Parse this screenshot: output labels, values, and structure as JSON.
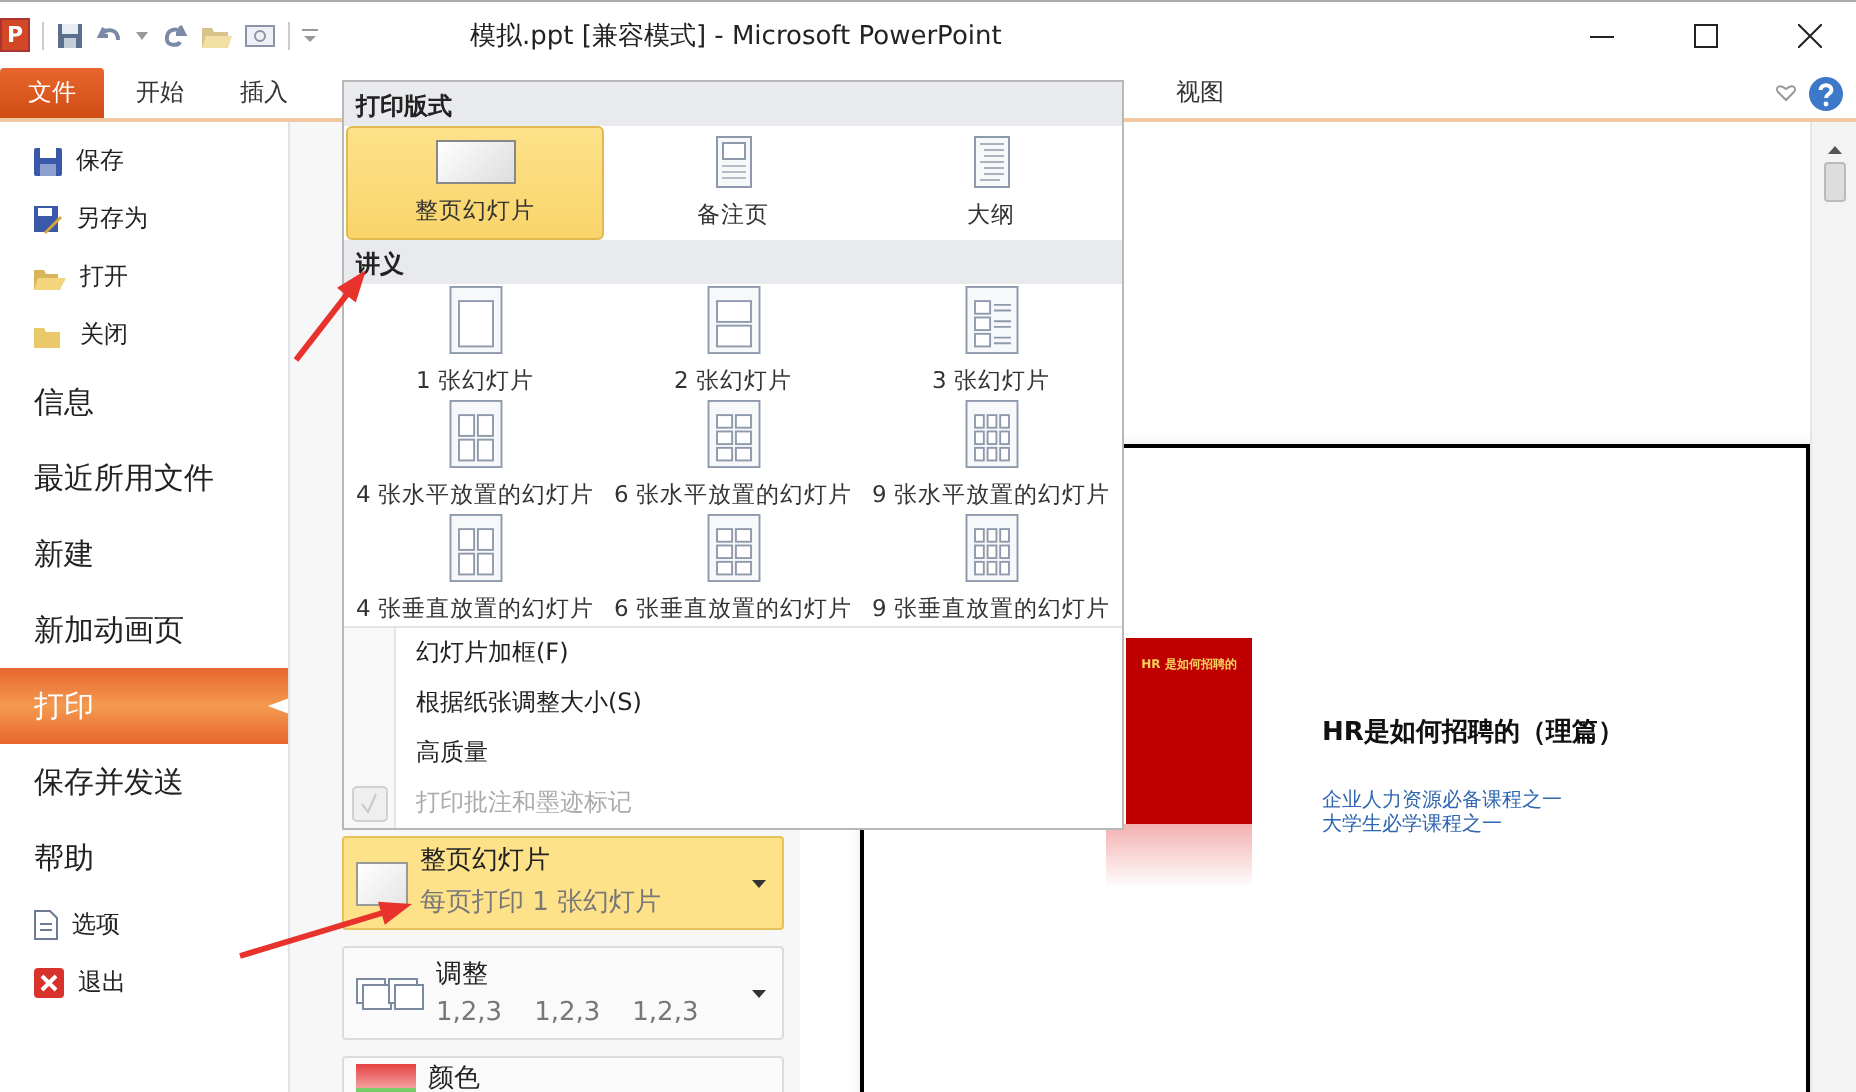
{
  "title_bar": {
    "app_icon_letter": "P",
    "title": "模拟.ppt [兼容模式] - Microsoft PowerPoint"
  },
  "ribbon": {
    "file_tab": "文件",
    "tabs": [
      {
        "label": "开始"
      },
      {
        "label": "插入"
      },
      {
        "label": "视图"
      }
    ]
  },
  "backstage_nav": [
    {
      "label": "保存",
      "kind": "command",
      "selected": false
    },
    {
      "label": "另存为",
      "kind": "command",
      "selected": false
    },
    {
      "label": "打开",
      "kind": "command",
      "selected": false
    },
    {
      "label": "关闭",
      "kind": "command",
      "selected": false
    },
    {
      "label": "信息",
      "kind": "page",
      "selected": false
    },
    {
      "label": "最近所用文件",
      "kind": "page",
      "selected": false
    },
    {
      "label": "新建",
      "kind": "page",
      "selected": false
    },
    {
      "label": "新加动画页",
      "kind": "page",
      "selected": false
    },
    {
      "label": "打印",
      "kind": "page",
      "selected": true
    },
    {
      "label": "保存并发送",
      "kind": "page",
      "selected": false
    },
    {
      "label": "帮助",
      "kind": "page",
      "selected": false
    },
    {
      "label": "选项",
      "kind": "command",
      "selected": false
    },
    {
      "label": "退出",
      "kind": "command",
      "selected": false
    }
  ],
  "print_settings": [
    {
      "kind": "layout",
      "title": "整页幻灯片",
      "subtitle": "每页打印 1 张幻灯片",
      "expanded": true
    },
    {
      "kind": "collate",
      "title": "调整",
      "sequences": [
        "1,2,3",
        "1,2,3",
        "1,2,3"
      ],
      "expanded": false
    },
    {
      "kind": "color",
      "title": "颜色",
      "expanded": false
    }
  ],
  "layout_menu": {
    "sections": [
      {
        "heading": "打印版式",
        "options": [
          {
            "label": "整页幻灯片",
            "selected": true
          },
          {
            "label": "备注页",
            "selected": false
          },
          {
            "label": "大纲",
            "selected": false
          }
        ]
      },
      {
        "heading": "讲义",
        "options": [
          {
            "label": "1 张幻灯片",
            "selected": false
          },
          {
            "label": "2 张幻灯片",
            "selected": false
          },
          {
            "label": "3 张幻灯片",
            "selected": false
          },
          {
            "label": "4 张水平放置的幻灯片",
            "selected": false
          },
          {
            "label": "6 张水平放置的幻灯片",
            "selected": false
          },
          {
            "label": "9 张水平放置的幻灯片",
            "selected": false
          },
          {
            "label": "4 张垂直放置的幻灯片",
            "selected": false
          },
          {
            "label": "6 张垂直放置的幻灯片",
            "selected": false
          },
          {
            "label": "9 张垂直放置的幻灯片",
            "selected": false
          }
        ]
      }
    ],
    "toggles": [
      {
        "label": "幻灯片加框(F)",
        "checked": false,
        "disabled": false
      },
      {
        "label": "根据纸张调整大小(S)",
        "checked": false,
        "disabled": false
      },
      {
        "label": "高质量",
        "checked": false,
        "disabled": false
      },
      {
        "label": "打印批注和墨迹标记",
        "checked": true,
        "disabled": true
      }
    ]
  },
  "preview": {
    "cover_title": "HR 是如何招聘的",
    "title": "HR是如何招聘的（理篇）",
    "subtitle_lines": [
      "企业人力资源必备课程之一",
      "大学生必学课程之一"
    ]
  }
}
